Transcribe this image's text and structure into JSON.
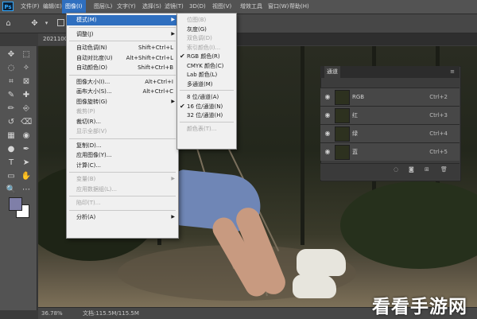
{
  "menubar": {
    "logo": "Ps",
    "items": [
      "文件(F)",
      "编辑(E)",
      "图像(I)",
      "图层(L)",
      "文字(Y)",
      "选择(S)",
      "滤镜(T)",
      "3D(D)",
      "视图(V)",
      "增效工具",
      "窗口(W)",
      "帮助(H)"
    ],
    "active_index": 2
  },
  "document": {
    "tab_title": "2021100..."
  },
  "statusbar": {
    "zoom": "36.78%",
    "doc_info": "文档:115.5M/115.5M"
  },
  "image_menu": {
    "items": [
      {
        "label": "模式(M)",
        "shortcut": "",
        "submenu": true,
        "highlighted": true,
        "disabled": false
      },
      {
        "sep": true
      },
      {
        "label": "调整(J)",
        "shortcut": "",
        "submenu": true,
        "disabled": false
      },
      {
        "sep": true
      },
      {
        "label": "自动色调(N)",
        "shortcut": "Shift+Ctrl+L",
        "disabled": false
      },
      {
        "label": "自动对比度(U)",
        "shortcut": "Alt+Shift+Ctrl+L",
        "disabled": false
      },
      {
        "label": "自动颜色(O)",
        "shortcut": "Shift+Ctrl+B",
        "disabled": false
      },
      {
        "sep": true
      },
      {
        "label": "图像大小(I)...",
        "shortcut": "Alt+Ctrl+I",
        "disabled": false
      },
      {
        "label": "画布大小(S)...",
        "shortcut": "Alt+Ctrl+C",
        "disabled": false
      },
      {
        "label": "图像旋转(G)",
        "shortcut": "",
        "submenu": true,
        "disabled": false
      },
      {
        "label": "裁剪(P)",
        "shortcut": "",
        "disabled": true
      },
      {
        "label": "裁切(R)...",
        "shortcut": "",
        "disabled": false
      },
      {
        "label": "显示全部(V)",
        "shortcut": "",
        "disabled": true
      },
      {
        "sep": true
      },
      {
        "label": "复制(D)...",
        "shortcut": "",
        "disabled": false
      },
      {
        "label": "应用图像(Y)...",
        "shortcut": "",
        "disabled": false
      },
      {
        "label": "计算(C)...",
        "shortcut": "",
        "disabled": false
      },
      {
        "sep": true
      },
      {
        "label": "变量(B)",
        "shortcut": "",
        "submenu": true,
        "disabled": true
      },
      {
        "label": "应用数据组(L)...",
        "shortcut": "",
        "disabled": true
      },
      {
        "sep": true
      },
      {
        "label": "陷印(T)...",
        "shortcut": "",
        "disabled": true
      },
      {
        "sep": true
      },
      {
        "label": "分析(A)",
        "shortcut": "",
        "submenu": true,
        "disabled": false
      }
    ]
  },
  "mode_submenu": {
    "items": [
      {
        "label": "位图(B)",
        "disabled": true,
        "checked": false
      },
      {
        "label": "灰度(G)",
        "disabled": false,
        "checked": false
      },
      {
        "label": "双色调(D)",
        "disabled": true,
        "checked": false
      },
      {
        "label": "索引颜色(I)...",
        "disabled": true,
        "checked": false
      },
      {
        "label": "RGB 颜色(R)",
        "disabled": false,
        "checked": true
      },
      {
        "label": "CMYK 颜色(C)",
        "disabled": false,
        "checked": false
      },
      {
        "label": "Lab 颜色(L)",
        "disabled": false,
        "checked": false
      },
      {
        "label": "多通道(M)",
        "disabled": false,
        "checked": false
      },
      {
        "sep": true
      },
      {
        "label": "8 位/通道(A)",
        "disabled": false,
        "checked": false
      },
      {
        "label": "16 位/通道(N)",
        "disabled": false,
        "checked": true
      },
      {
        "label": "32 位/通道(H)",
        "disabled": false,
        "checked": false
      },
      {
        "sep": true
      },
      {
        "label": "颜色表(T)...",
        "disabled": true,
        "checked": false
      }
    ]
  },
  "channels_panel": {
    "title": "通道",
    "channels": [
      {
        "name": "RGB",
        "shortcut": "Ctrl+2"
      },
      {
        "name": "红",
        "shortcut": "Ctrl+3"
      },
      {
        "name": "绿",
        "shortcut": "Ctrl+4"
      },
      {
        "name": "蓝",
        "shortcut": "Ctrl+5"
      }
    ],
    "footer_icons": [
      "dotted-circle-icon",
      "mask-icon",
      "new-channel-icon",
      "trash-icon"
    ]
  },
  "toolbar": {
    "tools": [
      "move-icon",
      "marquee-icon",
      "lasso-icon",
      "magic-wand-icon",
      "crop-icon",
      "frame-icon",
      "eyedropper-icon",
      "healing-icon",
      "brush-icon",
      "stamp-icon",
      "history-brush-icon",
      "eraser-icon",
      "gradient-icon",
      "blur-icon",
      "dodge-icon",
      "pen-icon",
      "type-icon",
      "path-select-icon",
      "shape-icon",
      "hand-icon",
      "zoom-icon",
      "more-icon"
    ],
    "foreground_color": "#7f7fa8",
    "background_color": "#ffffff"
  },
  "watermark": "看看手游网",
  "colors": {
    "accent": "#2f6fbf",
    "menu_bg": "#f0f0f0",
    "panel_bg": "#3c3c3c"
  }
}
